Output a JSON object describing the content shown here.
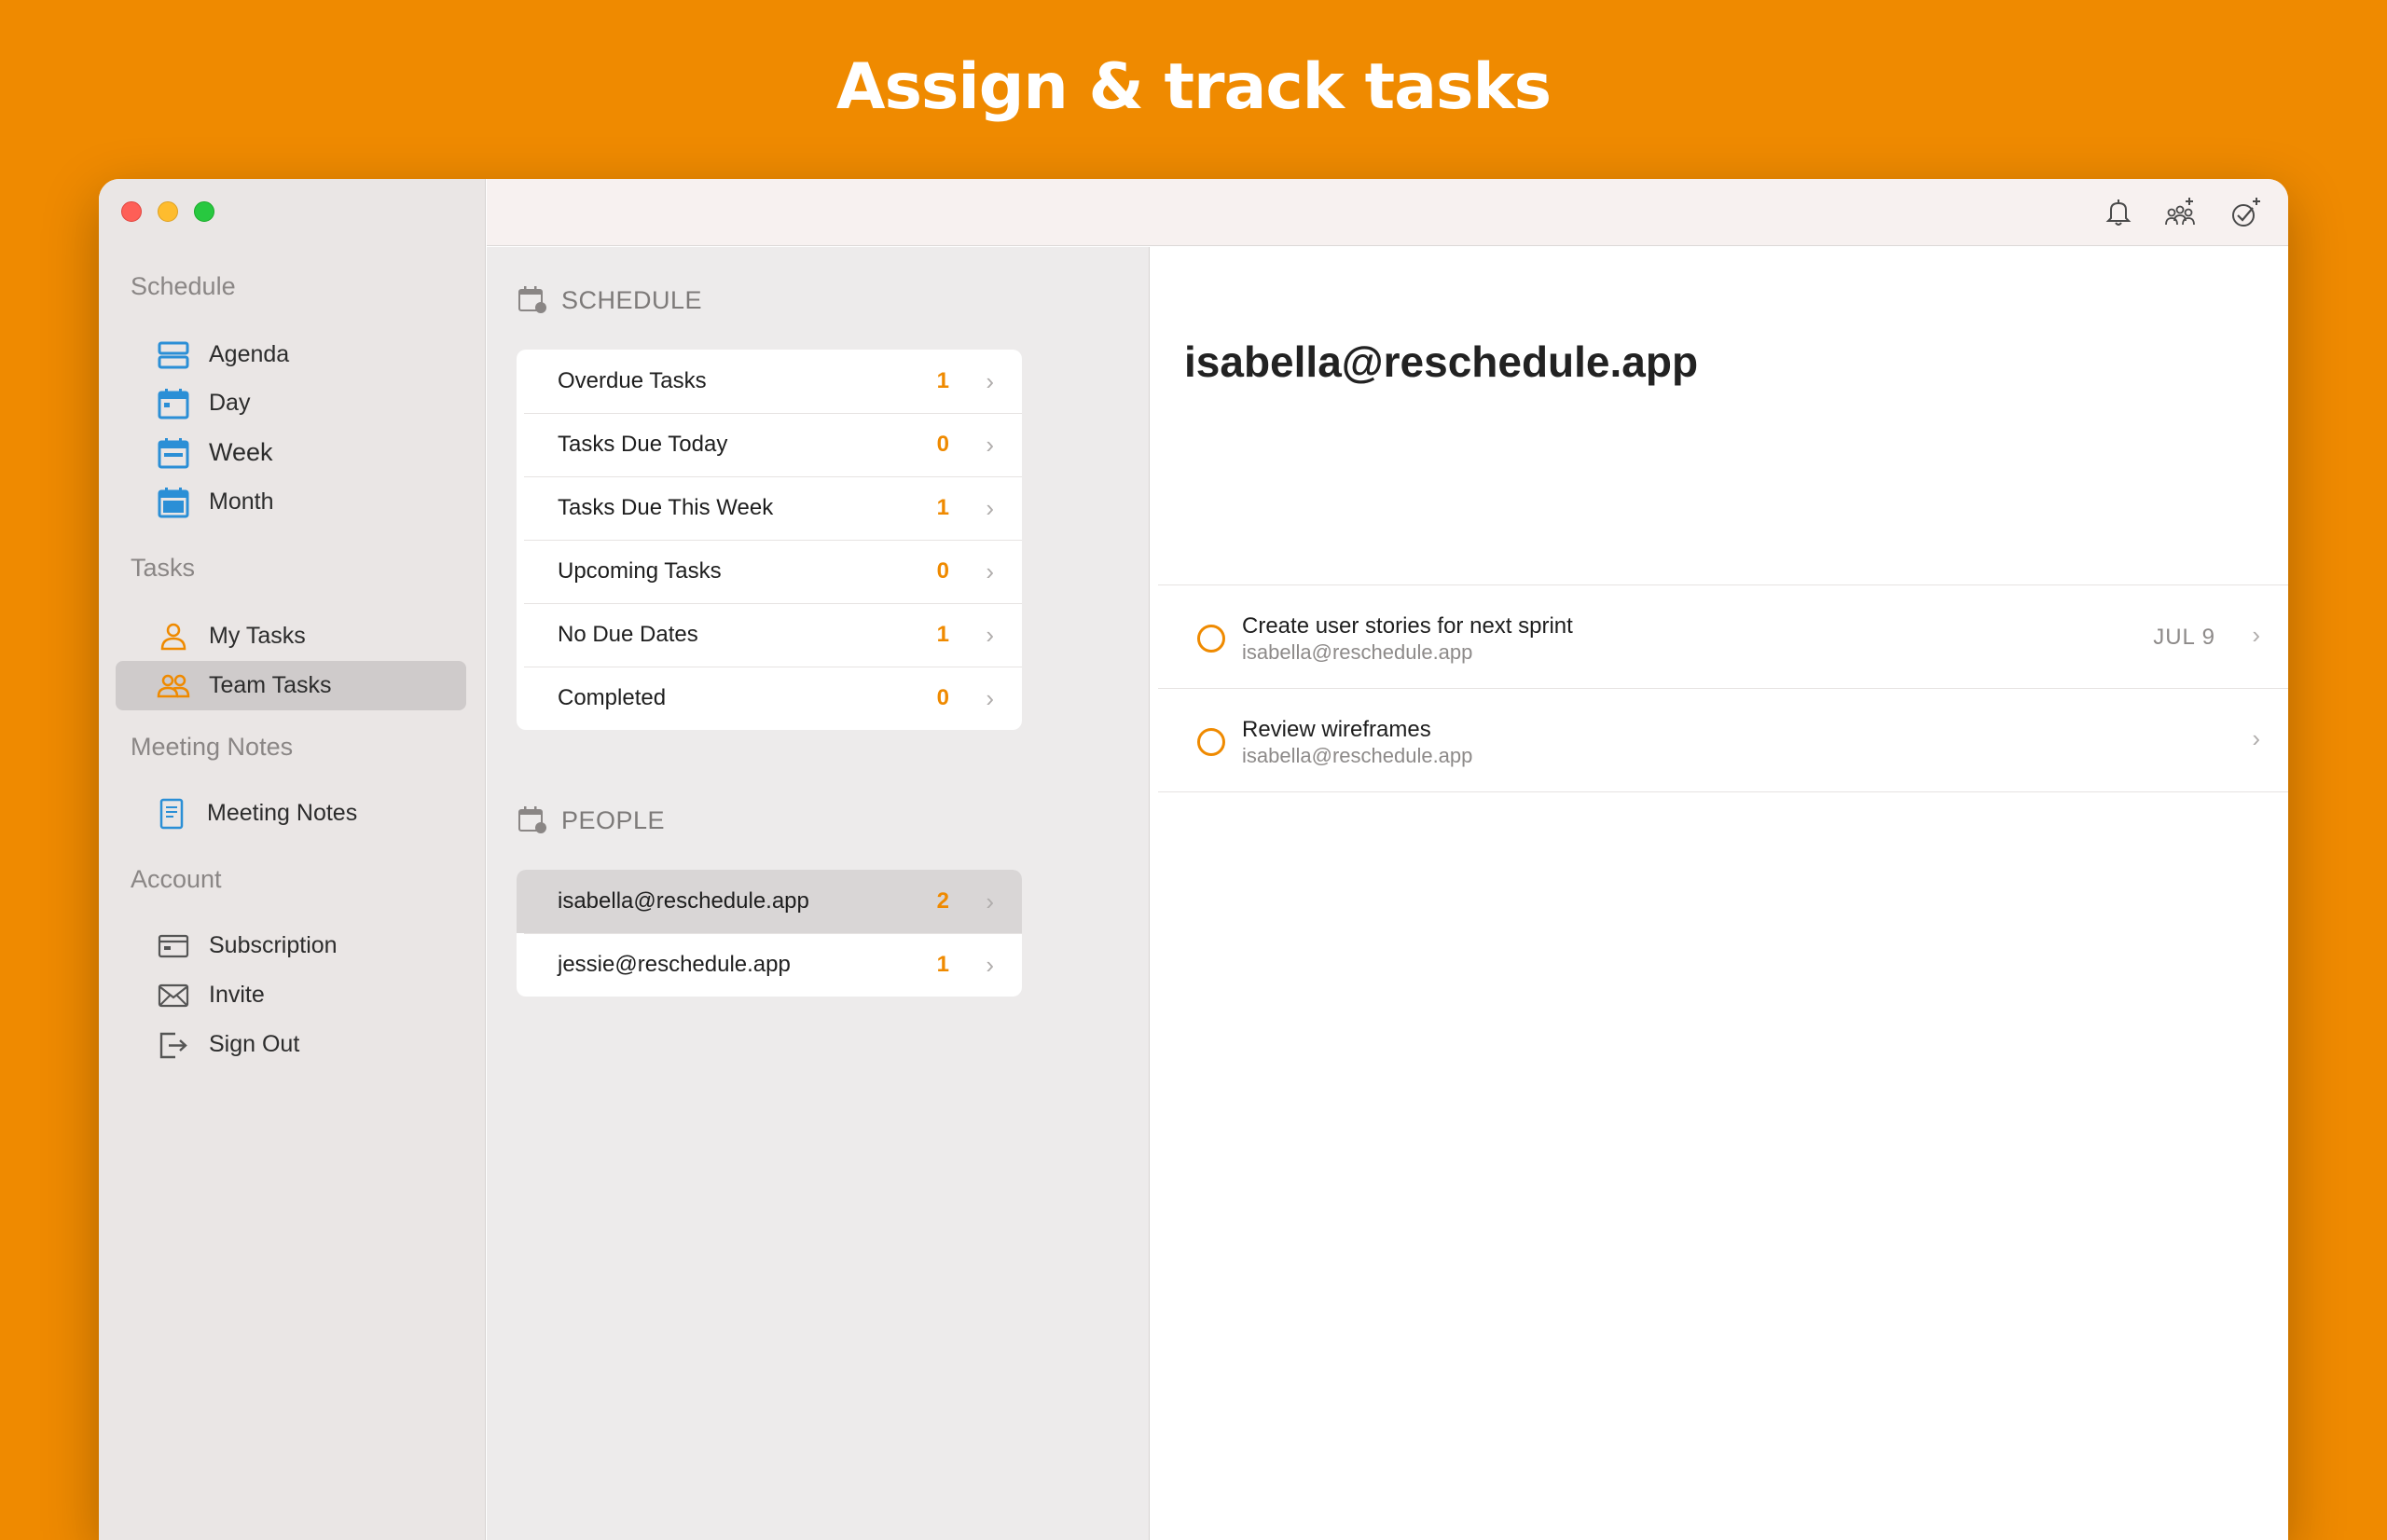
{
  "headline": "Assign & track tasks",
  "sidebar": {
    "sections": [
      {
        "title": "Schedule"
      },
      {
        "title": "Tasks"
      },
      {
        "title": "Meeting Notes"
      },
      {
        "title": "Account"
      }
    ],
    "items": [
      {
        "label": "Agenda",
        "icon": "agenda-icon"
      },
      {
        "label": "Day",
        "icon": "calendar-day-icon"
      },
      {
        "label": "Week",
        "icon": "calendar-week-icon"
      },
      {
        "label": "Month",
        "icon": "calendar-month-icon"
      },
      {
        "label": "My Tasks",
        "icon": "person-icon"
      },
      {
        "label": "Team Tasks",
        "icon": "people-icon",
        "selected": true
      },
      {
        "label": "Meeting Notes",
        "icon": "note-icon"
      },
      {
        "label": "Subscription",
        "icon": "card-icon"
      },
      {
        "label": "Invite",
        "icon": "envelope-icon"
      },
      {
        "label": "Sign Out",
        "icon": "sign-out-icon"
      }
    ]
  },
  "toolbar": {
    "icons": [
      "bell-icon",
      "add-people-icon",
      "add-task-icon"
    ]
  },
  "schedule": {
    "header": "SCHEDULE",
    "rows": [
      {
        "label": "Overdue Tasks",
        "count": "1"
      },
      {
        "label": "Tasks Due Today",
        "count": "0"
      },
      {
        "label": "Tasks Due This Week",
        "count": "1"
      },
      {
        "label": "Upcoming Tasks",
        "count": "0"
      },
      {
        "label": "No Due Dates",
        "count": "1"
      },
      {
        "label": "Completed",
        "count": "0"
      }
    ]
  },
  "people": {
    "header": "PEOPLE",
    "rows": [
      {
        "label": "isabella@reschedule.app",
        "count": "2",
        "selected": true
      },
      {
        "label": "jessie@reschedule.app",
        "count": "1"
      }
    ]
  },
  "detail": {
    "title": "isabella@reschedule.app",
    "tasks": [
      {
        "title": "Create user stories for next sprint",
        "assignee": "isabella@reschedule.app",
        "due": "JUL 9"
      },
      {
        "title": "Review wireframes",
        "assignee": "isabella@reschedule.app",
        "due": ""
      }
    ]
  },
  "colors": {
    "accent": "#EF8A00",
    "calendar_blue": "#2B8FD6",
    "selected_bg": "#CFCBCB"
  },
  "chevron": "›"
}
